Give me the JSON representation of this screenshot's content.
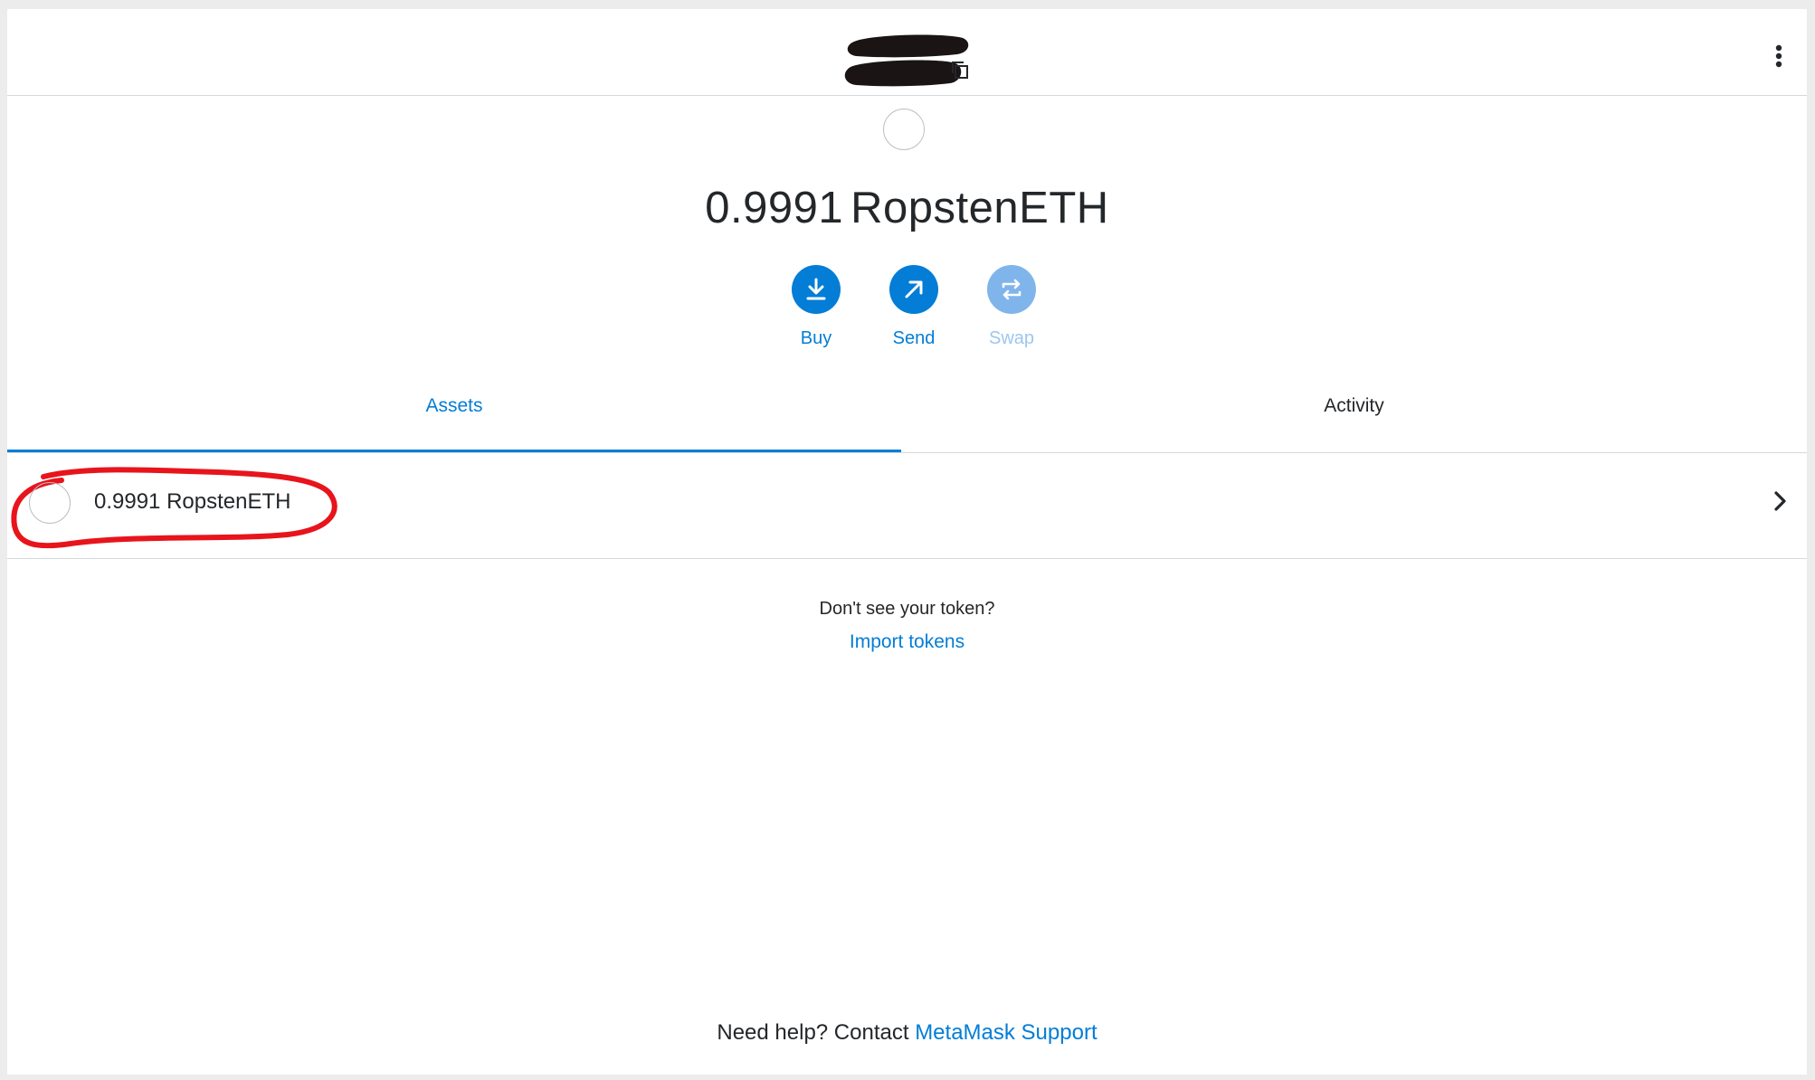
{
  "header": {
    "account_name_redacted": true,
    "copy_icon": "copy-icon",
    "menu_icon": "vertical-dots-icon"
  },
  "balance": {
    "amount": "0.9991",
    "currency": "RopstenETH"
  },
  "actions": [
    {
      "label": "Buy",
      "icon": "download-icon",
      "enabled": true
    },
    {
      "label": "Send",
      "icon": "arrow-up-right-icon",
      "enabled": true
    },
    {
      "label": "Swap",
      "icon": "swap-icon",
      "enabled": false
    }
  ],
  "tabs": [
    {
      "label": "Assets",
      "active": true
    },
    {
      "label": "Activity",
      "active": false
    }
  ],
  "assets": [
    {
      "text": "0.9991 RopstenETH",
      "annotated": true
    }
  ],
  "import": {
    "question": "Don't see your token?",
    "link": "Import tokens"
  },
  "footer": {
    "prefix": "Need help? Contact ",
    "link": "MetaMask Support"
  },
  "colors": {
    "accent": "#037dd6",
    "accent_disabled": "#7fb5eb",
    "annotation": "#e8141c",
    "text": "#24272a"
  }
}
